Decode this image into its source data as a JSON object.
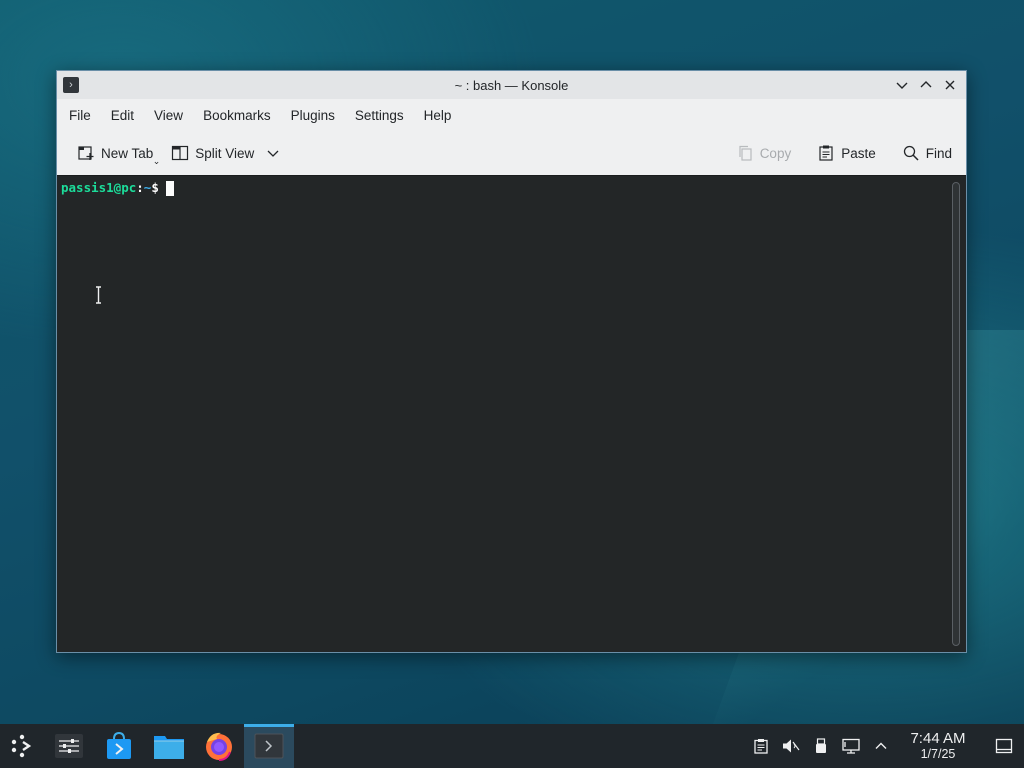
{
  "window": {
    "title": "~ : bash — Konsole",
    "app_icon": "terminal-icon",
    "controls": [
      "minimize-icon",
      "maximize-icon",
      "close-icon"
    ]
  },
  "menubar": {
    "items": [
      {
        "label": "File"
      },
      {
        "label": "Edit"
      },
      {
        "label": "View"
      },
      {
        "label": "Bookmarks"
      },
      {
        "label": "Plugins"
      },
      {
        "label": "Settings"
      },
      {
        "label": "Help"
      }
    ]
  },
  "toolbar": {
    "new_tab_label": "New Tab",
    "split_view_label": "Split View",
    "copy_label": "Copy",
    "paste_label": "Paste",
    "find_label": "Find",
    "copy_enabled": false
  },
  "terminal": {
    "prompt_user_host": "passis1@pc",
    "prompt_sep": ":",
    "prompt_path": "~",
    "prompt_symbol": "$",
    "background": "#232627",
    "user_color": "#1cdc9a",
    "path_color": "#3daee9"
  },
  "taskbar": {
    "launcher_icon": "kde-launcher-icon",
    "tasks": [
      {
        "name": "system-settings-icon"
      },
      {
        "name": "discover-store-icon"
      },
      {
        "name": "dolphin-files-icon"
      },
      {
        "name": "firefox-icon"
      },
      {
        "name": "konsole-icon",
        "active": true
      }
    ],
    "tray": [
      "clipboard-icon",
      "volume-muted-icon",
      "usb-device-icon",
      "network-wired-icon",
      "tray-expand-icon"
    ],
    "clock_time": "7:44 AM",
    "clock_date": "1/7/25",
    "accent": "#3daee9"
  }
}
